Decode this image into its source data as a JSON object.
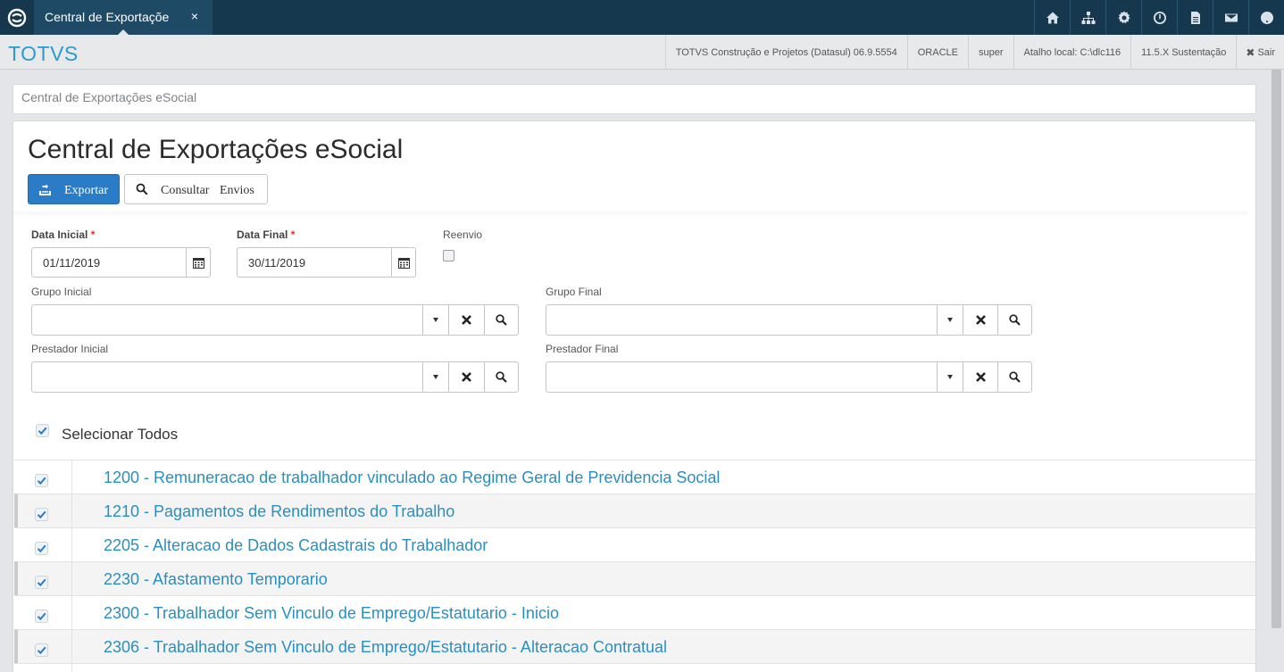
{
  "topbar": {
    "tab_label": "Central de Exportaçõe",
    "tab_close": "×",
    "icons": [
      "home-icon",
      "sitemap-icon",
      "gear-icon",
      "clock-icon",
      "document-icon",
      "mail-icon",
      "help-icon"
    ]
  },
  "subbar": {
    "brand": "TOTVS",
    "product": "TOTVS Construção e Projetos (Datasul) 06.9.5554",
    "database": "ORACLE",
    "user": "super",
    "shortcut": "Atalho local: C:\\dlc116",
    "version": "11.5.X Sustentação",
    "exit_label": "Sair"
  },
  "breadcrumb": "Central de Exportações eSocial",
  "main": {
    "title": "Central de Exportações eSocial",
    "export_label": "Exportar",
    "consult_label": "Consultar Envios"
  },
  "form": {
    "data_inicial": {
      "label": "Data Inicial",
      "value": "01/11/2019"
    },
    "data_final": {
      "label": "Data Final",
      "value": "30/11/2019"
    },
    "required_mark": "*",
    "reenvio": {
      "label": "Reenvio",
      "checked": false
    },
    "grupo_inicial": {
      "label": "Grupo Inicial",
      "value": ""
    },
    "grupo_final": {
      "label": "Grupo Final",
      "value": ""
    },
    "prestador_inicial": {
      "label": "Prestador Inicial",
      "value": ""
    },
    "prestador_final": {
      "label": "Prestador Final",
      "value": ""
    }
  },
  "select_all": {
    "label": "Selecionar Todos",
    "checked": true
  },
  "events": [
    {
      "label": "1200 - Remuneracao de trabalhador vinculado ao Regime Geral de Previdencia Social",
      "checked": true
    },
    {
      "label": "1210 - Pagamentos de Rendimentos do Trabalho",
      "checked": true
    },
    {
      "label": "2205 - Alteracao de Dados Cadastrais do Trabalhador",
      "checked": true
    },
    {
      "label": "2230 - Afastamento Temporario",
      "checked": true
    },
    {
      "label": "2300 - Trabalhador Sem Vinculo de Emprego/Estatutario - Inicio",
      "checked": true
    },
    {
      "label": "2306 - Trabalhador Sem Vinculo de Emprego/Estatutario - Alteracao Contratual",
      "checked": true
    }
  ],
  "colors": {
    "accent": "#2a9ad1",
    "topbar": "#16384e",
    "primary_button": "#2a7cc7",
    "link": "#2a8fc0"
  }
}
